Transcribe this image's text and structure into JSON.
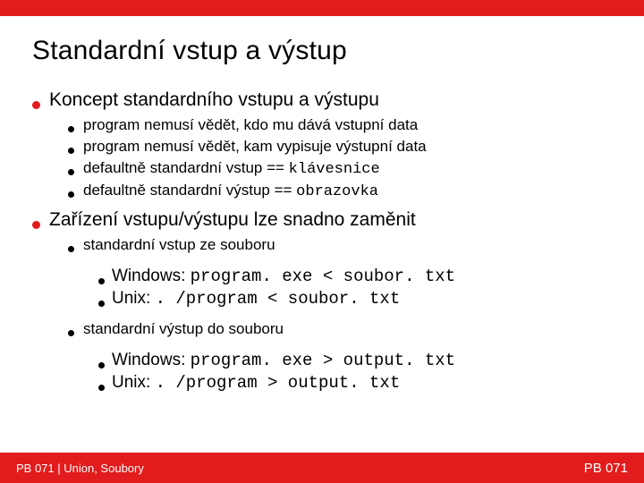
{
  "title": "Standardní vstup a výstup",
  "sections": [
    {
      "heading": "Koncept standardního vstupu a výstupu",
      "items": [
        {
          "text": "program nemusí vědět, kdo mu dává vstupní data"
        },
        {
          "text": "program nemusí vědět, kam vypisuje výstupní data"
        },
        {
          "text_pre": "defaultně standardní vstup == ",
          "code": "klávesnice"
        },
        {
          "text_pre": "defaultně standardní výstup == ",
          "code": "obrazovka"
        }
      ]
    },
    {
      "heading": "Zařízení vstupu/výstupu lze snadno zaměnit",
      "items": [
        {
          "text": "standardní vstup ze souboru",
          "children": [
            {
              "label": "Windows: ",
              "code": "program. exe < soubor. txt"
            },
            {
              "label": "Unix: ",
              "code": ". /program < soubor. txt"
            }
          ]
        },
        {
          "text": "standardní výstup do souboru",
          "children": [
            {
              "label": "Windows: ",
              "code": "program. exe > output. txt"
            },
            {
              "label": "Unix: ",
              "code": ". /program > output. txt"
            }
          ]
        }
      ]
    }
  ],
  "footer": {
    "left": "PB 071 | Union, Soubory",
    "right": "PB 071"
  }
}
